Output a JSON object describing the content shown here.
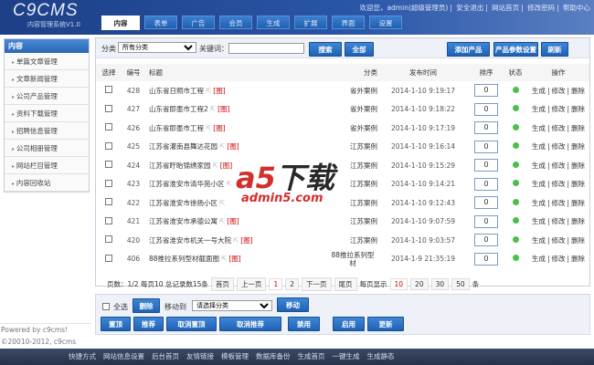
{
  "header": {
    "logo": "C9CMS",
    "subtitle": "内容管理系统V1.0",
    "welcome": "欢迎您，admin(超级管理员)",
    "links": [
      "安全退出",
      "网站首页",
      "修改密码",
      "帮助中心"
    ]
  },
  "tabs": [
    "内容",
    "表单",
    "广告",
    "会员",
    "生成",
    "扩展",
    "界面",
    "设置"
  ],
  "sidebar": {
    "title": "内容",
    "items": [
      "单篇文章管理",
      "文章新闻管理",
      "公司产品管理",
      "资料下载管理",
      "招聘信息管理",
      "公司相册管理",
      "网站栏目管理",
      "内容回收站"
    ]
  },
  "powered": [
    "Powered by c9cms!",
    "©20010-2012, c9cms"
  ],
  "toolbar": {
    "category_label": "分类",
    "category_value": "所有分类",
    "keyword_label": "关键词：",
    "keyword_value": "",
    "search": "搜索",
    "all": "全部",
    "add": "添加产品",
    "params": "产品参数设置",
    "refresh": "刷新"
  },
  "columns": [
    "选择",
    "编号",
    "标题",
    "分类",
    "发布时间",
    "排序",
    "状态",
    "操作"
  ],
  "rows": [
    {
      "id": "428",
      "title": "山东省日照市工程",
      "img": "[图]",
      "cat": "省外案例",
      "time": "2014-1-10 9:19:17",
      "order": "0"
    },
    {
      "id": "427",
      "title": "山东省即墨市工程2",
      "img": "[图]",
      "cat": "省外案例",
      "time": "2014-1-10 9:18:22",
      "order": "0"
    },
    {
      "id": "426",
      "title": "山东省即墨市工程",
      "img": "[图]",
      "cat": "省外案例",
      "time": "2014-1-10 9:17:19",
      "order": "0"
    },
    {
      "id": "425",
      "title": "江苏省灌南县舞达花园",
      "img": "[图]",
      "cat": "江苏案例",
      "time": "2014-1-10 9:16:14",
      "order": "0"
    },
    {
      "id": "424",
      "title": "江苏省盱眙锦绣家园",
      "img": "[图]",
      "cat": "江苏案例",
      "time": "2014-1-10 9:15:29",
      "order": "0"
    },
    {
      "id": "423",
      "title": "江苏省淮安市清华苑小区",
      "img": "",
      "cat": "江苏案例",
      "time": "2014-1-10 9:14:21",
      "order": "0"
    },
    {
      "id": "422",
      "title": "江苏省淮安市徐扬小区",
      "img": "",
      "cat": "江苏案例",
      "time": "2014-1-10 9:12:43",
      "order": "0"
    },
    {
      "id": "421",
      "title": "江苏省淮安市承德公寓",
      "img": "[图]",
      "cat": "江苏案例",
      "time": "2014-1-10 9:07:59",
      "order": "0"
    },
    {
      "id": "420",
      "title": "江苏省淮安市机关一号大院",
      "img": "[图]",
      "cat": "江苏案例",
      "time": "2014-1-10 9:03:57",
      "order": "0"
    },
    {
      "id": "406",
      "title": "88推拉系列型材截面图",
      "img": "[图]",
      "cat": "88推拉系列型材",
      "time": "2014-1-9 21:35:19",
      "order": "0"
    }
  ],
  "actions": {
    "gen": "生成",
    "edit": "修改",
    "del": "删除",
    "sep": "|"
  },
  "pager": {
    "info": "页数：1/2 每页10 总记录数15条",
    "first": "首页",
    "prev": "上一页",
    "pages": [
      "1",
      "2"
    ],
    "next": "下一页",
    "last": "尾页",
    "per_label": "每页显示",
    "per": [
      "10",
      "20",
      "30",
      "50"
    ],
    "unit": "条"
  },
  "bulk": {
    "select_all": "全选",
    "delete": "删除",
    "move_label": "移动到",
    "move_value": "请选择分类",
    "move": "移动",
    "buttons": [
      "置顶",
      "推荐",
      "取消置顶",
      "取消推荐",
      "禁用",
      "启用",
      "更新"
    ]
  },
  "footer": [
    "快捷方式",
    "网站信息设置",
    "后台首页",
    "友情链接",
    "模板管理",
    "数据库备份",
    "生成首页",
    "一键生成",
    "生成静态"
  ],
  "watermark": {
    "logo": "a5下载",
    "domain": "admin5.com"
  },
  "colors": {
    "header": "#1d3f86",
    "button": "#2a6fc4",
    "ok": "#4bbf4b"
  }
}
